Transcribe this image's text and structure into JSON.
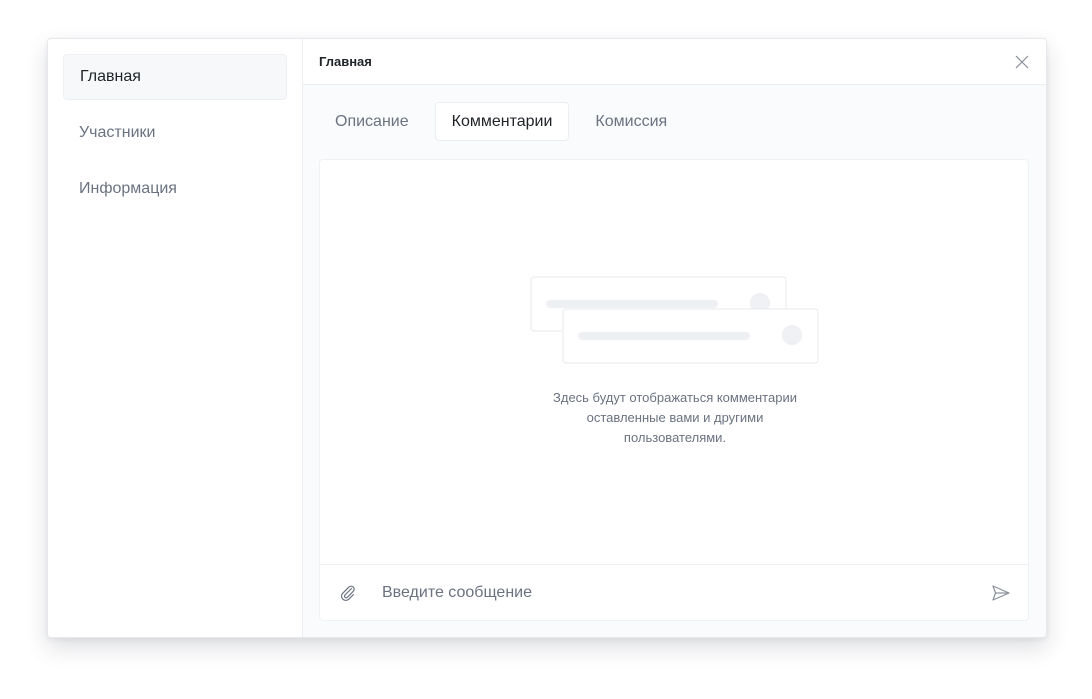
{
  "sidebar": {
    "items": [
      {
        "label": "Главная",
        "active": true
      },
      {
        "label": "Участники",
        "active": false
      },
      {
        "label": "Информация",
        "active": false
      }
    ]
  },
  "header": {
    "title": "Главная",
    "close_icon": "close-icon"
  },
  "tabs": [
    {
      "label": "Описание",
      "active": false
    },
    {
      "label": "Комментарии",
      "active": true
    },
    {
      "label": "Комиссия",
      "active": false
    }
  ],
  "comments": {
    "empty_line1": "Здесь будут отображаться комментарии",
    "empty_line2": "оставленные вами и другими",
    "empty_line3": "пользователями."
  },
  "composer": {
    "placeholder": "Введите сообщение",
    "value": "",
    "attach_icon": "paperclip-icon",
    "send_icon": "send-icon"
  },
  "colors": {
    "text_primary": "#1f2328",
    "text_secondary": "#6b7280",
    "border": "#eceef1",
    "background": "#fafbfc"
  }
}
